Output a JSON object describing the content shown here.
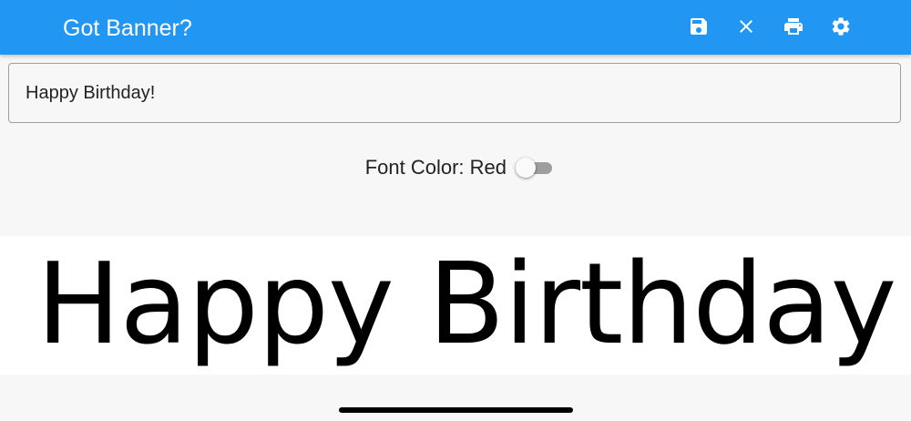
{
  "appbar": {
    "title": "Got Banner?",
    "background_color": "#2196f3",
    "actions": [
      {
        "icon": "save-icon",
        "label": "Save"
      },
      {
        "icon": "close-icon",
        "label": "Clear"
      },
      {
        "icon": "print-icon",
        "label": "Print"
      },
      {
        "icon": "settings-icon",
        "label": "Settings"
      }
    ]
  },
  "input": {
    "value": "Happy Birthday!",
    "placeholder": ""
  },
  "font_color": {
    "label": "Font Color: Red",
    "switch_on": false
  },
  "banner": {
    "text": "Happy Birthday!",
    "text_color": "#000000"
  }
}
